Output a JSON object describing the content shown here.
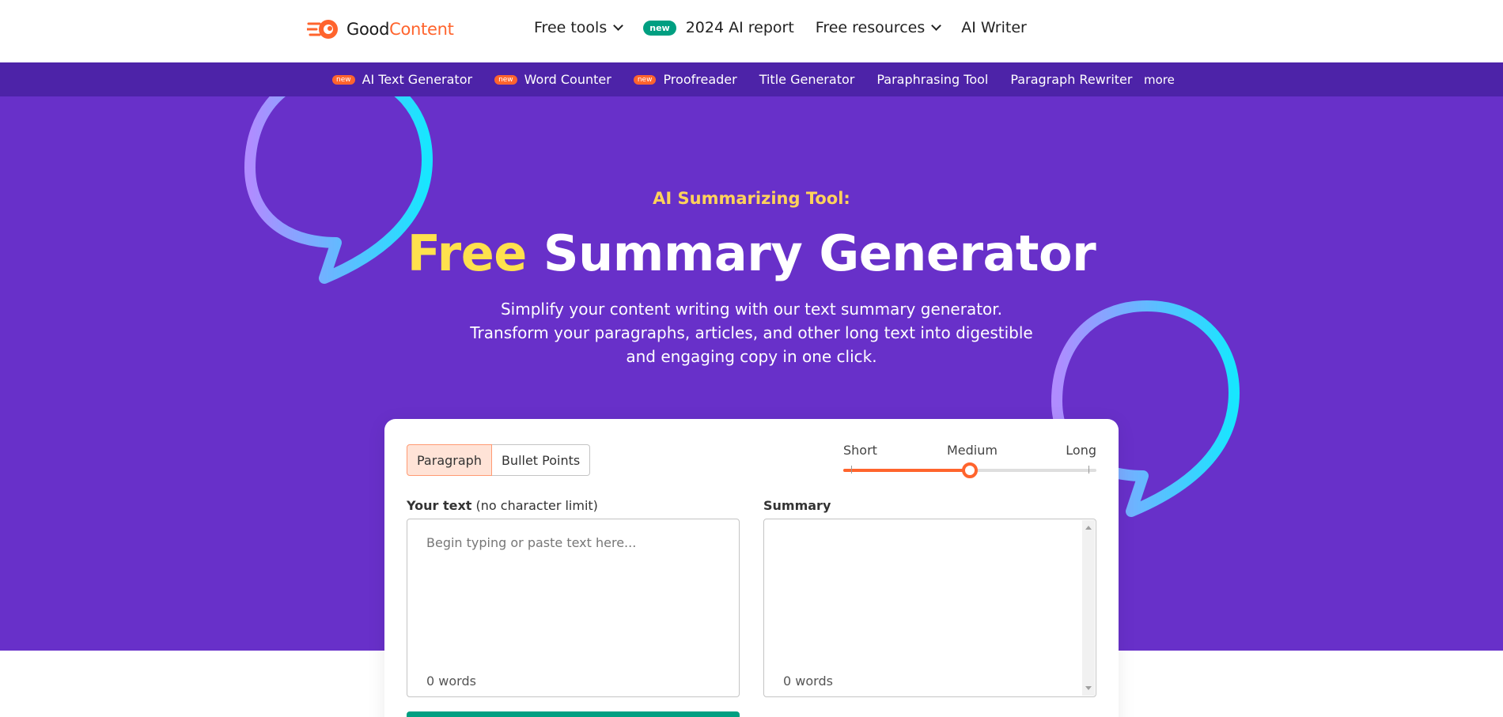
{
  "brand": {
    "good": "Good",
    "content": "Content"
  },
  "nav": {
    "free_tools": "Free tools",
    "new_badge": "new",
    "ai_report": "2024 AI report",
    "free_resources": "Free resources",
    "ai_writer": "AI Writer"
  },
  "subnav": {
    "new_badge": "new",
    "items": [
      "AI Text Generator",
      "Word Counter",
      "Proofreader",
      "Title Generator",
      "Paraphrasing Tool",
      "Paragraph Rewriter"
    ],
    "more": "more"
  },
  "hero": {
    "eyebrow": "AI Summarizing Tool:",
    "title_highlight": "Free",
    "title_rest": " Summary Generator",
    "description": "Simplify your content writing with our text summary generator. Transform your paragraphs, articles, and other long text into digestible and engaging copy in one click."
  },
  "tool": {
    "mode_options": [
      "Paragraph",
      "Bullet Points"
    ],
    "mode_selected": "Paragraph",
    "length_labels": [
      "Short",
      "Medium",
      "Long"
    ],
    "length_selected": "Medium",
    "length_value_fraction": 0.5,
    "input_label": "Your text",
    "input_hint": " (no character limit)",
    "input_placeholder": "Begin typing or paste text here...",
    "input_word_count": "0 words",
    "summary_label": "Summary",
    "summary_word_count": "0 words"
  },
  "colors": {
    "accent": "#ff642d",
    "hero_bg": "#6830c9",
    "subnav_bg": "#4d23a8",
    "highlight": "#ffe14d",
    "green": "#009f81"
  }
}
